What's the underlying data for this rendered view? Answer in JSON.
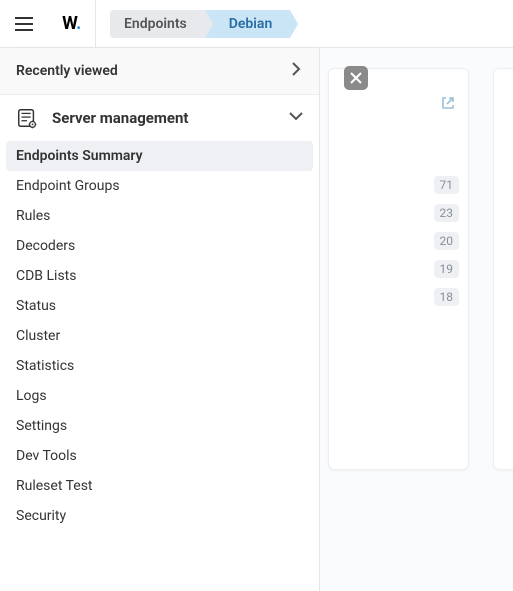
{
  "header": {
    "logo_text": "W",
    "breadcrumbs": [
      {
        "label": "Endpoints",
        "active": false
      },
      {
        "label": "Debian",
        "active": true
      }
    ]
  },
  "sidebar": {
    "recent_label": "Recently viewed",
    "section_title": "Server management",
    "items": [
      {
        "label": "Endpoints Summary",
        "active": true
      },
      {
        "label": "Endpoint Groups",
        "active": false
      },
      {
        "label": "Rules",
        "active": false
      },
      {
        "label": "Decoders",
        "active": false
      },
      {
        "label": "CDB Lists",
        "active": false
      },
      {
        "label": "Status",
        "active": false
      },
      {
        "label": "Cluster",
        "active": false
      },
      {
        "label": "Statistics",
        "active": false
      },
      {
        "label": "Logs",
        "active": false
      },
      {
        "label": "Settings",
        "active": false
      },
      {
        "label": "Dev Tools",
        "active": false
      },
      {
        "label": "Ruleset Test",
        "active": false
      },
      {
        "label": "Security",
        "active": false
      }
    ]
  },
  "content": {
    "counts": [
      71,
      23,
      20,
      19,
      18
    ]
  }
}
